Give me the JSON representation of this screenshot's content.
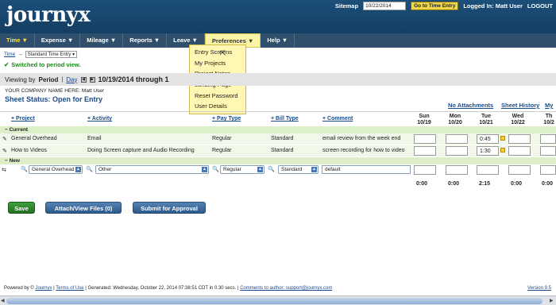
{
  "header": {
    "logo": "journyx",
    "sitemap": "Sitemap",
    "date_value": "10/22/2014",
    "goto_label": "Go to Time Entry",
    "logged_in": "Logged In: Matt User",
    "logout": "LOGOUT"
  },
  "nav": {
    "items": [
      {
        "label": "Time ▼"
      },
      {
        "label": "Expense ▼"
      },
      {
        "label": "Mileage ▼"
      },
      {
        "label": "Reports ▼"
      },
      {
        "label": "Leave ▼"
      },
      {
        "label": "Preferences ▼"
      },
      {
        "label": "Help ▼"
      }
    ]
  },
  "dropdown": {
    "items": [
      "Entry Screens",
      "My Projects",
      "Project Notes",
      "Landing Page",
      "Reset Password",
      "User Details"
    ]
  },
  "subbar": {
    "time_link": "Time",
    "arrow": "→",
    "entry_type": "Standard Time Entry"
  },
  "status_message": "Switched to period view.",
  "viewbar": {
    "viewing_by": "Viewing by",
    "period": "Period",
    "separator": "|",
    "day": "Day",
    "dates": "10/19/2014 through 1"
  },
  "company": "YOUR COMPANY NAME HERE: Matt User",
  "sheet_status": "Sheet Status: Open for Entry",
  "links": {
    "no_attachments": "No Attachments",
    "sheet_history": "Sheet History",
    "my": "My"
  },
  "columns": {
    "project": "Project",
    "activity": "Activity",
    "pay_type": "Pay Type",
    "bill_type": "Bill Type",
    "comment": "Comment"
  },
  "days": [
    {
      "dow": "Sun",
      "date": "10/19"
    },
    {
      "dow": "Mon",
      "date": "10/20"
    },
    {
      "dow": "Tue",
      "date": "10/21"
    },
    {
      "dow": "Wed",
      "date": "10/22"
    },
    {
      "dow": "Th",
      "date": "10/2"
    }
  ],
  "sections": {
    "current": "− Current",
    "new": "− New"
  },
  "rows": [
    {
      "project": "General Overhead",
      "activity": "Email",
      "pay_type": "Regular",
      "bill_type": "Standard",
      "comment": "email review from the week end",
      "tue": "0:45"
    },
    {
      "project": "How to Videos",
      "activity": "Doing Screen capture and Audio Recording",
      "pay_type": "Regular",
      "bill_type": "Standard",
      "comment": "screen recording for how to video",
      "tue": "1:30"
    }
  ],
  "new_row": {
    "project": "General Overhead",
    "activity": "Other",
    "pay_type": "Regular",
    "bill_type": "Standard",
    "comment": "default"
  },
  "totals": [
    "0:00",
    "0:00",
    "2:15",
    "0:00",
    "0:00"
  ],
  "buttons": {
    "save": "Save",
    "attach": "Attach/View Files (0)",
    "submit": "Submit for Approval"
  },
  "footer": {
    "powered": "Powered by ©",
    "journyx": "Journyx",
    "sep1": "|",
    "terms": "Terms of Use",
    "generated": "| Generated: Wednesday, October 22, 2014 07:38:51 CDT in 0.30 secs. |",
    "comments": "Comments to author: support@journyx.com",
    "version": "Version 9.5"
  },
  "icons": {
    "pencil": "pencil-icon",
    "magnifier": "magnifier-icon",
    "note": "note-icon",
    "check": "check-icon"
  },
  "colors": {
    "header_bg": "#1c4f7a",
    "nav_bg": "#2f4f6d",
    "menu_highlight": "#fff7b3",
    "section_green": "#dcefc9",
    "link_blue": "#1a4b8c"
  }
}
